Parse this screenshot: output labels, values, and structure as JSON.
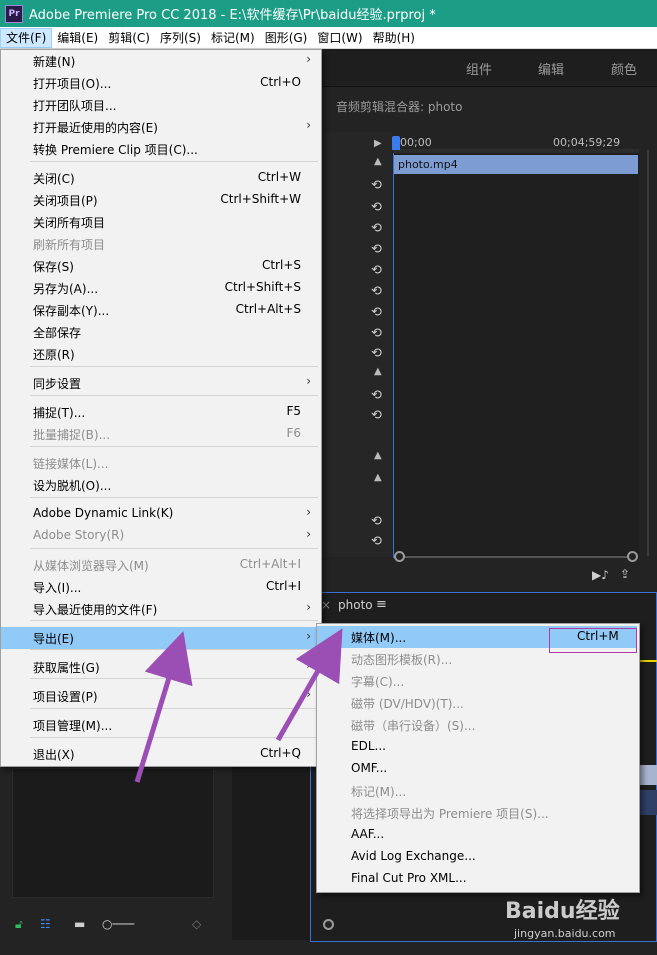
{
  "window": {
    "app_icon": "Pr",
    "title": "Adobe Premiere Pro CC 2018 - E:\\软件缓存\\Pr\\baidu经验.prproj *"
  },
  "menubar": {
    "items": [
      "文件(F)",
      "编辑(E)",
      "剪辑(C)",
      "序列(S)",
      "标记(M)",
      "图形(G)",
      "窗口(W)",
      "帮助(H)"
    ]
  },
  "workspace_tabs": [
    "组件",
    "编辑",
    "颜色"
  ],
  "mixer": {
    "title": "音频剪辑混合器: photo",
    "timecode_start": "00;00",
    "timecode_end": "00;04;59;29",
    "clip_name": "photo.mp4"
  },
  "sequence": {
    "name": "photo",
    "menu_icon": "≡"
  },
  "file_menu": {
    "items": [
      {
        "label": "新建(N)",
        "shortcut": "",
        "submenu": true,
        "disabled": false
      },
      {
        "label": "打开项目(O)...",
        "shortcut": "Ctrl+O",
        "submenu": false,
        "disabled": false
      },
      {
        "label": "打开团队项目...",
        "shortcut": "",
        "submenu": false,
        "disabled": false
      },
      {
        "label": "打开最近使用的内容(E)",
        "shortcut": "",
        "submenu": true,
        "disabled": false
      },
      {
        "label": "转换 Premiere Clip 项目(C)...",
        "shortcut": "",
        "submenu": false,
        "disabled": false
      },
      {
        "label": "关闭(C)",
        "shortcut": "Ctrl+W",
        "submenu": false,
        "disabled": false
      },
      {
        "label": "关闭项目(P)",
        "shortcut": "Ctrl+Shift+W",
        "submenu": false,
        "disabled": false
      },
      {
        "label": "关闭所有项目",
        "shortcut": "",
        "submenu": false,
        "disabled": false
      },
      {
        "label": "刷新所有项目",
        "shortcut": "",
        "submenu": false,
        "disabled": true
      },
      {
        "label": "保存(S)",
        "shortcut": "Ctrl+S",
        "submenu": false,
        "disabled": false
      },
      {
        "label": "另存为(A)...",
        "shortcut": "Ctrl+Shift+S",
        "submenu": false,
        "disabled": false
      },
      {
        "label": "保存副本(Y)...",
        "shortcut": "Ctrl+Alt+S",
        "submenu": false,
        "disabled": false
      },
      {
        "label": "全部保存",
        "shortcut": "",
        "submenu": false,
        "disabled": false
      },
      {
        "label": "还原(R)",
        "shortcut": "",
        "submenu": false,
        "disabled": false
      },
      {
        "label": "同步设置",
        "shortcut": "",
        "submenu": true,
        "disabled": false
      },
      {
        "label": "捕捉(T)...",
        "shortcut": "F5",
        "submenu": false,
        "disabled": false
      },
      {
        "label": "批量捕捉(B)...",
        "shortcut": "F6",
        "submenu": false,
        "disabled": true
      },
      {
        "label": "链接媒体(L)...",
        "shortcut": "",
        "submenu": false,
        "disabled": true
      },
      {
        "label": "设为脱机(O)...",
        "shortcut": "",
        "submenu": false,
        "disabled": false
      },
      {
        "label": "Adobe Dynamic Link(K)",
        "shortcut": "",
        "submenu": true,
        "disabled": false
      },
      {
        "label": "Adobe Story(R)",
        "shortcut": "",
        "submenu": true,
        "disabled": true
      },
      {
        "label": "从媒体浏览器导入(M)",
        "shortcut": "Ctrl+Alt+I",
        "submenu": false,
        "disabled": true
      },
      {
        "label": "导入(I)...",
        "shortcut": "Ctrl+I",
        "submenu": false,
        "disabled": false
      },
      {
        "label": "导入最近使用的文件(F)",
        "shortcut": "",
        "submenu": true,
        "disabled": false
      },
      {
        "label": "导出(E)",
        "shortcut": "",
        "submenu": true,
        "disabled": false,
        "highlighted": true
      },
      {
        "label": "获取属性(G)",
        "shortcut": "",
        "submenu": true,
        "disabled": false
      },
      {
        "label": "项目设置(P)",
        "shortcut": "",
        "submenu": true,
        "disabled": false
      },
      {
        "label": "项目管理(M)...",
        "shortcut": "",
        "submenu": false,
        "disabled": false
      },
      {
        "label": "退出(X)",
        "shortcut": "Ctrl+Q",
        "submenu": false,
        "disabled": false
      }
    ]
  },
  "export_menu": {
    "items": [
      {
        "label": "媒体(M)...",
        "shortcut": "Ctrl+M",
        "disabled": false,
        "highlighted": true
      },
      {
        "label": "动态图形模板(R)...",
        "shortcut": "",
        "disabled": true
      },
      {
        "label": "字幕(C)...",
        "shortcut": "",
        "disabled": true
      },
      {
        "label": "磁带 (DV/HDV)(T)...",
        "shortcut": "",
        "disabled": true
      },
      {
        "label": "磁带（串行设备）(S)...",
        "shortcut": "",
        "disabled": true
      },
      {
        "label": "EDL...",
        "shortcut": "",
        "disabled": false
      },
      {
        "label": "OMF...",
        "shortcut": "",
        "disabled": false
      },
      {
        "label": "标记(M)...",
        "shortcut": "",
        "disabled": true
      },
      {
        "label": "将选择项导出为 Premiere 项目(S)...",
        "shortcut": "",
        "disabled": true
      },
      {
        "label": "AAF...",
        "shortcut": "",
        "disabled": false
      },
      {
        "label": "Avid Log Exchange...",
        "shortcut": "",
        "disabled": false
      },
      {
        "label": "Final Cut Pro XML...",
        "shortcut": "",
        "disabled": false
      }
    ]
  },
  "watermark": {
    "logo": "Baidu经验",
    "url": "jingyan.baidu.com"
  },
  "colors": {
    "title_bar": "#1c9e86",
    "menu_highlight": "#91c9f7",
    "annotation_arrow": "#9b4fb5",
    "shortcut_box": "#b03aa8"
  }
}
